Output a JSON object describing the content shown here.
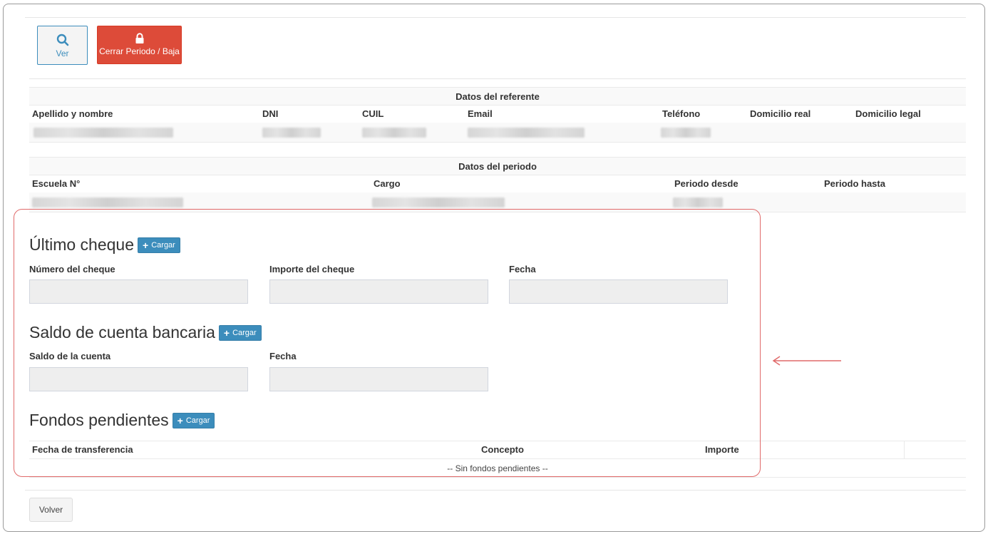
{
  "toolbar": {
    "ver_label": "Ver",
    "close_label": "Cerrar Periodo / Baja"
  },
  "referente": {
    "title": "Datos del referente",
    "columns": [
      "Apellido y nombre",
      "DNI",
      "CUIL",
      "Email",
      "Teléfono",
      "Domicilio real",
      "Domicilio legal"
    ]
  },
  "periodo": {
    "title": "Datos del periodo",
    "columns": [
      "Escuela N°",
      "Cargo",
      "Periodo desde",
      "Periodo hasta"
    ]
  },
  "ultimo_cheque": {
    "title": "Último cheque",
    "cargar_label": "Cargar",
    "fields": [
      "Número del cheque",
      "Importe del cheque",
      "Fecha"
    ]
  },
  "saldo_cuenta": {
    "title": "Saldo de cuenta bancaria",
    "cargar_label": "Cargar",
    "fields": [
      "Saldo de la cuenta",
      "Fecha"
    ]
  },
  "fondos": {
    "title": "Fondos pendientes",
    "cargar_label": "Cargar",
    "columns": [
      "Fecha de transferencia",
      "Concepto",
      "Importe"
    ],
    "empty_text": "-- Sin fondos pendientes --"
  },
  "footer": {
    "volver_label": "Volver"
  },
  "colors": {
    "primary": "#3c8dbc",
    "danger": "#dd4b39",
    "highlight": "#e06a6a"
  }
}
